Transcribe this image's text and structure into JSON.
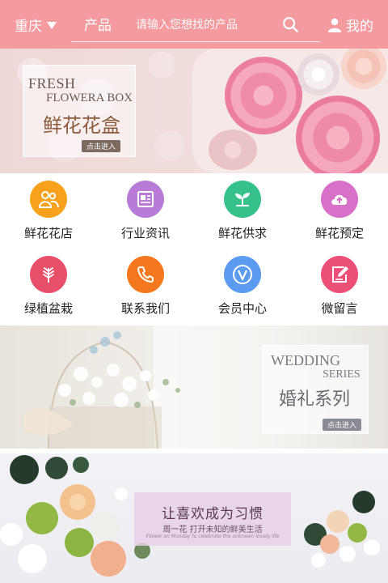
{
  "header": {
    "city": "重庆",
    "category": "产品",
    "search_placeholder": "请输入您想找的产品",
    "user_label": "我的",
    "bg_color": "#f49b9f"
  },
  "banners": [
    {
      "title_en_1": "FRESH",
      "title_en_2": "FLOWERA BOX",
      "title_cn": "鲜花花盒",
      "button_label": "点击进入"
    },
    {
      "title_en_1": "WEDDING",
      "title_en_2": "SERIES",
      "title_cn": "婚礼系列",
      "button_label": "点击进入"
    },
    {
      "title_cn": "让喜欢成为习惯",
      "subtitle": "周一花 打开未知的鲜美生活",
      "script": "Flower on Monday to celebrate the unknown lovely life"
    }
  ],
  "grid": [
    {
      "label": "鲜花花店",
      "icon": "shop-icon",
      "color": "#f7a11c"
    },
    {
      "label": "行业资讯",
      "icon": "news-icon",
      "color": "#b87bd8"
    },
    {
      "label": "鲜花供求",
      "icon": "sprout-icon",
      "color": "#36c08a"
    },
    {
      "label": "鲜花预定",
      "icon": "cloud-upload-icon",
      "color": "#d86fc9"
    },
    {
      "label": "绿植盆栽",
      "icon": "leaf-icon",
      "color": "#e8506a"
    },
    {
      "label": "联系我们",
      "icon": "phone-icon",
      "color": "#f5781e"
    },
    {
      "label": "会员中心",
      "icon": "vip-icon",
      "color": "#5b9cf0"
    },
    {
      "label": "微留言",
      "icon": "message-edit-icon",
      "color": "#ec4f78"
    }
  ]
}
